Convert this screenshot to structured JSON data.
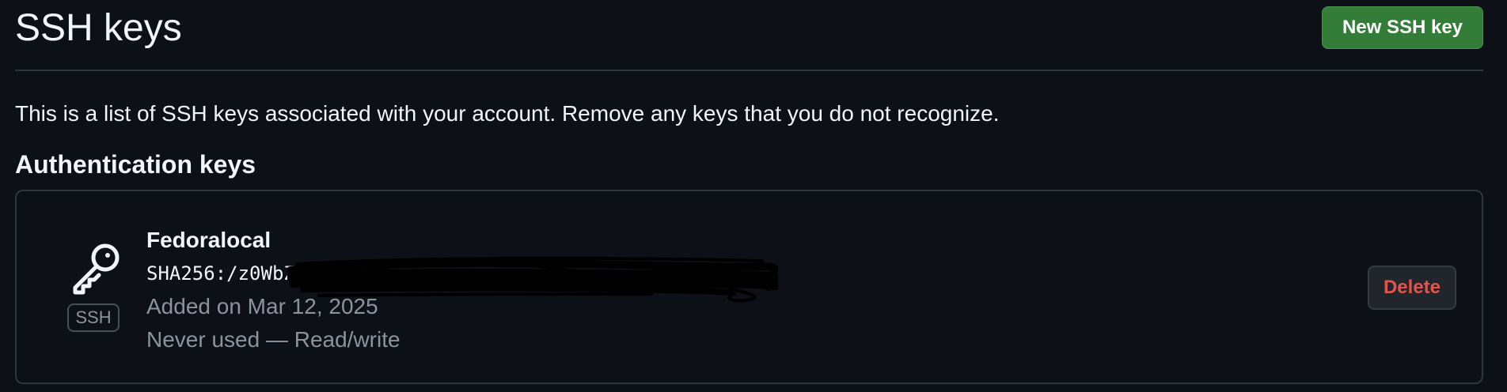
{
  "header": {
    "title": "SSH keys",
    "new_key_button": "New SSH key"
  },
  "intro_text": "This is a list of SSH keys associated with your account. Remove any keys that you do not recognize.",
  "section": {
    "title": "Authentication keys"
  },
  "keys": [
    {
      "title": "Fedoralocal",
      "fingerprint": "SHA256:/z0WbZE",
      "fingerprint_redacted": true,
      "added": "Added on Mar 12, 2025",
      "usage": "Never used — Read/write",
      "type_badge": "SSH",
      "icon": "key-icon",
      "delete_label": "Delete"
    }
  ],
  "colors": {
    "background": "#0d1117",
    "primary_button": "#347d39",
    "danger_text": "#e5534b",
    "border": "#30363d",
    "muted_text": "#8b949e"
  }
}
